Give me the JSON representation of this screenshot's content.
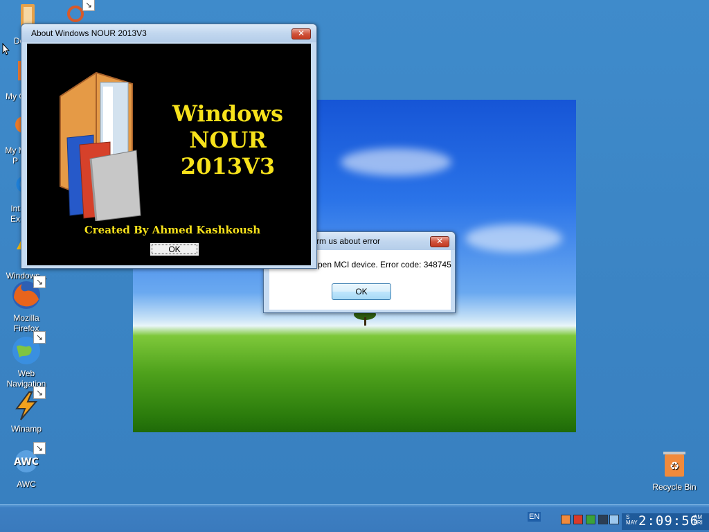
{
  "desktop_icons": [
    {
      "name": "documents",
      "label": "Docu"
    },
    {
      "name": "my-computer",
      "label": "My C"
    },
    {
      "name": "my-music",
      "label": "My M\nP"
    },
    {
      "name": "internet-explorer",
      "label": "Int\nEx"
    },
    {
      "name": "windows",
      "label": "C\nWindows..."
    },
    {
      "name": "mozilla-firefox",
      "label": "Mozilla\nFirefox"
    },
    {
      "name": "web-navigation",
      "label": "Web\nNavigation"
    },
    {
      "name": "winamp",
      "label": "Winamp"
    },
    {
      "name": "awc",
      "label": "AWC"
    },
    {
      "name": "recycle-bin",
      "label": "Recycle Bin"
    }
  ],
  "about_dialog": {
    "title": "About Windows NOUR 2013V3",
    "close_label": "✕",
    "heading_line1": "Windows",
    "heading_line2": "NOUR",
    "heading_line3": "2013V3",
    "credit": "Created By Ahmed Kashkoush",
    "ok_label": "OK"
  },
  "error_dialog": {
    "title": "rm us about error",
    "close_label": "✕",
    "message": "pen MCI device. Error code: 348745",
    "ok_label": "OK"
  },
  "taskbar": {
    "language": "EN",
    "clock": {
      "day_top": "S",
      "day_mid": "MAY",
      "time": "2:09:56",
      "ampm_top": "AM",
      "ampm_bottom": "FRI"
    }
  },
  "colors": {
    "desktop": "#3d86c6",
    "banner_text": "#f7e21b",
    "about_bg": "#000000"
  }
}
